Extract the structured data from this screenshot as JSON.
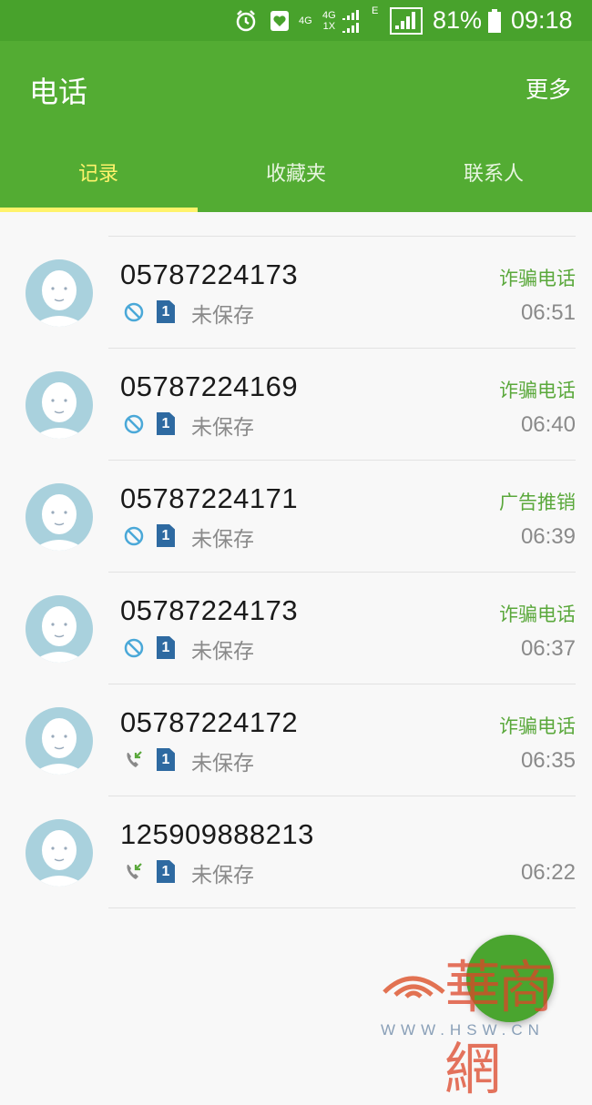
{
  "statusbar": {
    "network1": "4G",
    "network2": "4G",
    "network3": "1X",
    "edge": "E",
    "battery": "81%",
    "time": "09:18"
  },
  "header": {
    "title": "电话",
    "more": "更多"
  },
  "tabs": [
    {
      "label": "记录"
    },
    {
      "label": "收藏夹"
    },
    {
      "label": "联系人"
    }
  ],
  "calls": [
    {
      "number": "05787224173",
      "tag": "诈骗电话",
      "sim": "1",
      "saved": "未保存",
      "time": "06:51",
      "type": "blocked"
    },
    {
      "number": "05787224169",
      "tag": "诈骗电话",
      "sim": "1",
      "saved": "未保存",
      "time": "06:40",
      "type": "blocked"
    },
    {
      "number": "05787224171",
      "tag": "广告推销",
      "sim": "1",
      "saved": "未保存",
      "time": "06:39",
      "type": "blocked"
    },
    {
      "number": "05787224173",
      "tag": "诈骗电话",
      "sim": "1",
      "saved": "未保存",
      "time": "06:37",
      "type": "blocked"
    },
    {
      "number": "05787224172",
      "tag": "诈骗电话",
      "sim": "1",
      "saved": "未保存",
      "time": "06:35",
      "type": "incoming"
    },
    {
      "number": "125909888213",
      "tag": "",
      "sim": "1",
      "saved": "未保存",
      "time": "06:22",
      "type": "incoming"
    }
  ],
  "watermark": {
    "text": "華商網",
    "url": "WWW.HSW.CN"
  }
}
